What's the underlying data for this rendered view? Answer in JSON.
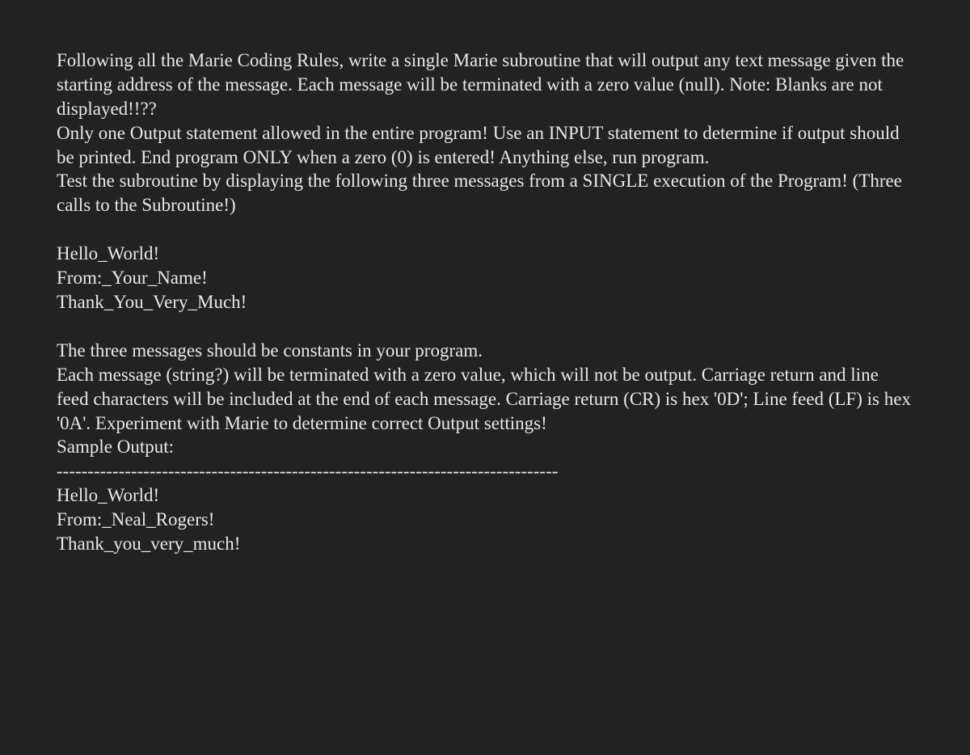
{
  "p1": "Following all the Marie Coding Rules, write a single Marie subroutine that will output any text message given the starting address of the message. Each message will be terminated with a zero value (null). Note: Blanks are not displayed!!??",
  "p2": "Only one Output statement allowed in the entire program! Use an INPUT statement to determine if output should be printed. End program ONLY when a zero (0) is entered! Anything else, run program.",
  "p3": "Test the subroutine by displaying the following three messages from a SINGLE execution of the Program! (Three calls to the Subroutine!)",
  "msg1": "Hello_World!",
  "msg2": "From:_Your_Name!",
  "msg3": "Thank_You_Very_Much!",
  "p4": "The three messages should be constants in your program.",
  "p5": "Each message (string?) will be terminated with a zero value, which will not be output. Carriage return and line feed characters will be included at the end of each message. Carriage return (CR) is hex '0D'; Line feed (LF) is hex '0A'. Experiment with Marie to determine correct Output settings!",
  "p6": "Sample Output:",
  "divider": "---------------------------------------------------------------------------------",
  "out1": "Hello_World!",
  "out2": "From:_Neal_Rogers!",
  "out3": "Thank_you_very_much!"
}
